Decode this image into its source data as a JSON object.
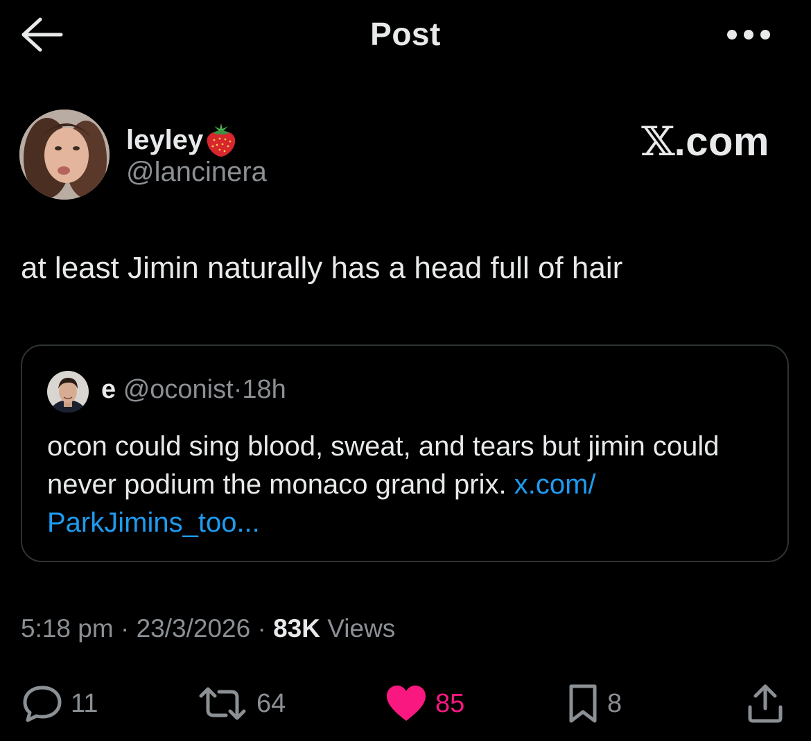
{
  "header": {
    "title": "Post",
    "back_icon": "arrow-left-icon",
    "more_icon": "more-horizontal-icon"
  },
  "author": {
    "display_name": "leyley",
    "badge_emoji": "strawberry",
    "handle": "@lancinera"
  },
  "watermark": {
    "glyph": "𝕏",
    "text": ".com"
  },
  "post": {
    "text": "at least Jimin naturally has a head full of hair"
  },
  "quote": {
    "name": "e",
    "handle": "@oconist",
    "separator": "·",
    "age": "18h",
    "text": "ocon could sing blood, sweat, and tears but jimin could never podium the monaco grand prix.",
    "link_text": "x.com/ ParkJimins_too..."
  },
  "meta": {
    "time": "5:18 pm",
    "separator": "·",
    "date": "23/3/2026",
    "views_count": "83K",
    "views_label": "Views"
  },
  "actions": {
    "replies": "11",
    "reposts": "64",
    "likes": "85",
    "bookmarks": "8"
  },
  "colors": {
    "background": "#000000",
    "text_primary": "#e7e9ea",
    "text_secondary": "#8b9095",
    "link": "#1d9bf0",
    "like": "#f91880",
    "border": "#2f3336"
  }
}
